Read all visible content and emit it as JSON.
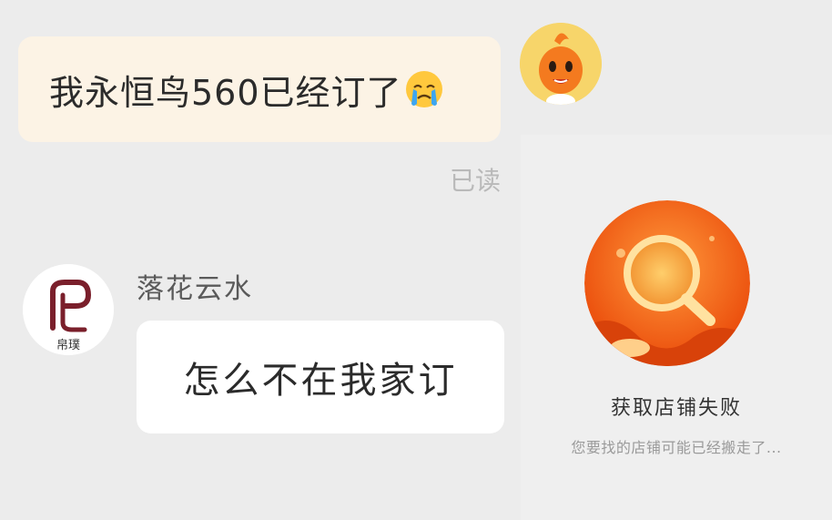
{
  "chat": {
    "outgoing": {
      "text": "我永恒鸟560已经订了",
      "emoji": "crying-face-icon",
      "status": "已读"
    },
    "incoming": {
      "sender_name": "落花云水",
      "text": "怎么不在我家订",
      "avatar_label": "帛璞"
    }
  },
  "store_card": {
    "title": "获取店铺失败",
    "subtitle": "您要找的店铺可能已经搬走了..."
  },
  "colors": {
    "outgoing_bubble": "#fcf3e5",
    "incoming_bubble": "#ffffff",
    "background": "#ececec",
    "accent_orange": "#f06a1e",
    "avatar_brand": "#7a1f2b"
  }
}
